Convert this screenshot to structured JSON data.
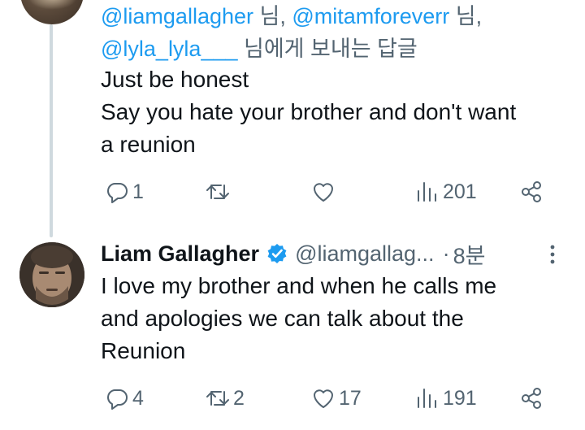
{
  "reply_context": {
    "mention_1": "@liamgallagher",
    "suffix_1": " 님,",
    "mention_2": "@mitamforeverr",
    "suffix_2": " 님,",
    "mention_3": "@lyla_lyla___",
    "suffix_3": " 님에게 보내는 답글"
  },
  "tweet1": {
    "text": "Just be honest\nSay you hate your brother and don't want\na reunion",
    "replies": "1",
    "retweets": "",
    "likes": "",
    "views": "201"
  },
  "tweet2": {
    "display_name": "Liam Gallagher",
    "handle": "@liamgallag...",
    "separator": "·",
    "time": "8분",
    "text": "I love my brother and when he calls me\nand apologies we can talk about the\nReunion",
    "replies": "4",
    "retweets": "2",
    "likes": "17",
    "views": "191"
  },
  "colors": {
    "accent": "#1d9bf0",
    "secondary_text": "#536471",
    "primary_text": "#0f1419",
    "thread_line": "#cfd9de"
  },
  "icons": [
    "reply-icon",
    "retweet-icon",
    "like-icon",
    "views-icon",
    "share-icon",
    "verified-badge-icon",
    "more-options-icon"
  ]
}
